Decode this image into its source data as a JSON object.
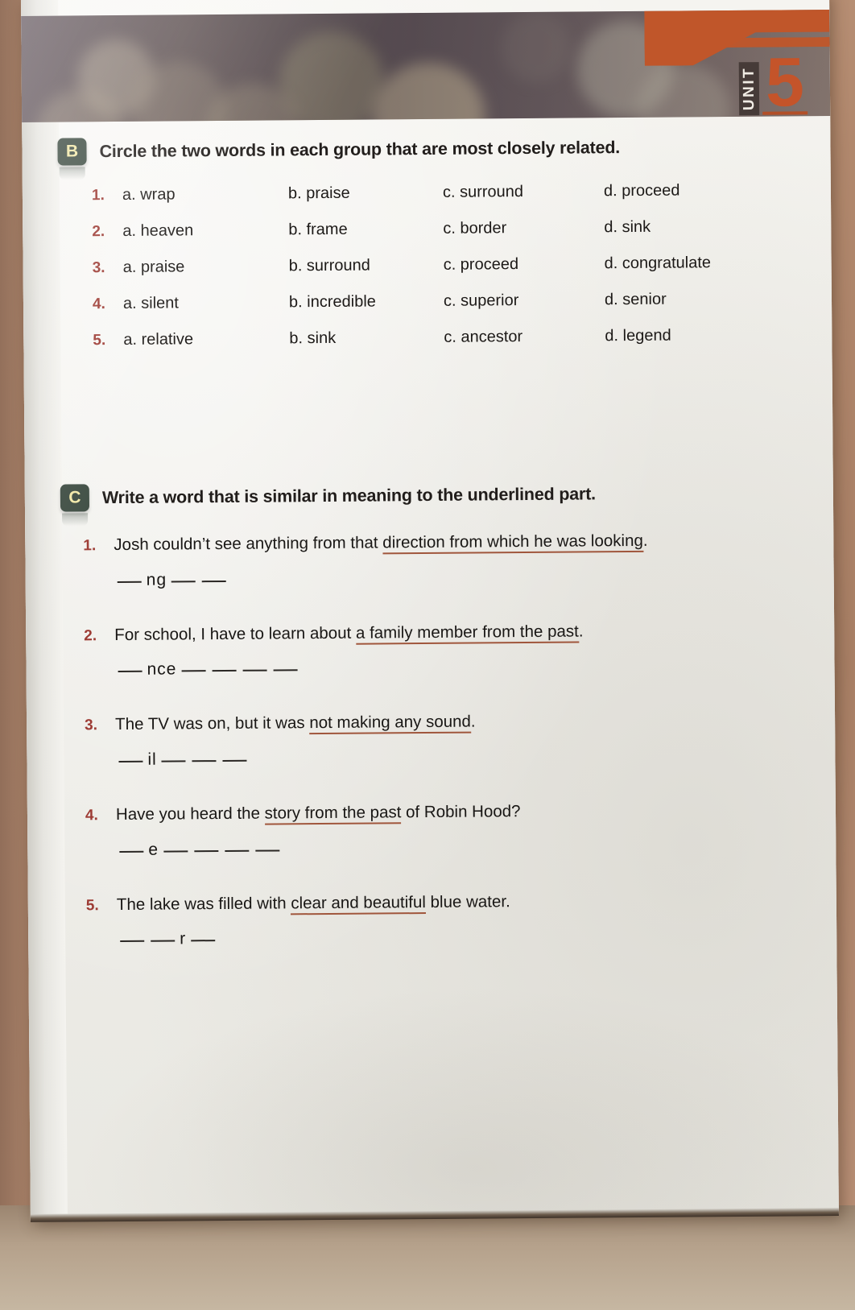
{
  "unit": {
    "word": "UNIT",
    "number": "5"
  },
  "sections": [
    {
      "badge": "B",
      "title": "Circle the two words in each group that are most closely related.",
      "groups": [
        {
          "num": "1.",
          "a": "a. wrap",
          "b": "b. praise",
          "c": "c. surround",
          "d": "d. proceed"
        },
        {
          "num": "2.",
          "a": "a. heaven",
          "b": "b. frame",
          "c": "c. border",
          "d": "d. sink"
        },
        {
          "num": "3.",
          "a": "a. praise",
          "b": "b. surround",
          "c": "c. proceed",
          "d": "d. congratulate"
        },
        {
          "num": "4.",
          "a": "a. silent",
          "b": "b. incredible",
          "c": "c. superior",
          "d": "d. senior"
        },
        {
          "num": "5.",
          "a": "a. relative",
          "b": "b. sink",
          "c": "c. ancestor",
          "d": "d. legend"
        }
      ]
    },
    {
      "badge": "C",
      "title": "Write a word that is similar in meaning to the underlined part.",
      "items": [
        {
          "num": "1.",
          "pre": "Josh couldn’t see anything from that ",
          "underlined": "direction from which he was looking",
          "post": ".",
          "answer_before_blanks": 1,
          "answer_fragment": "ng",
          "answer_after_blanks": 2
        },
        {
          "num": "2.",
          "pre": "For school, I have to learn about ",
          "underlined": "a family member from the past",
          "post": ".",
          "answer_before_blanks": 1,
          "answer_fragment": "nce",
          "answer_after_blanks": 4
        },
        {
          "num": "3.",
          "pre": "The TV was on, but it was ",
          "underlined": "not making any sound",
          "post": ".",
          "answer_before_blanks": 1,
          "answer_fragment": "il",
          "answer_after_blanks": 3
        },
        {
          "num": "4.",
          "pre": "Have you heard the ",
          "underlined": "story from the past",
          "post": " of Robin Hood?",
          "answer_before_blanks": 1,
          "answer_fragment": "e",
          "answer_after_blanks": 4
        },
        {
          "num": "5.",
          "pre": "The lake was filled with ",
          "underlined": "clear and beautiful",
          "post": " blue water.",
          "answer_before_blanks": 2,
          "answer_fragment": "r",
          "answer_after_blanks": 1
        }
      ]
    }
  ],
  "colors": {
    "badge_bg": "#3d4c42",
    "badge_text": "#f2e9a8",
    "number_red": "#9d3b34",
    "underline": "#a0563c",
    "unit_orange": "#c4542a",
    "banner_flag": "#c0562a"
  }
}
